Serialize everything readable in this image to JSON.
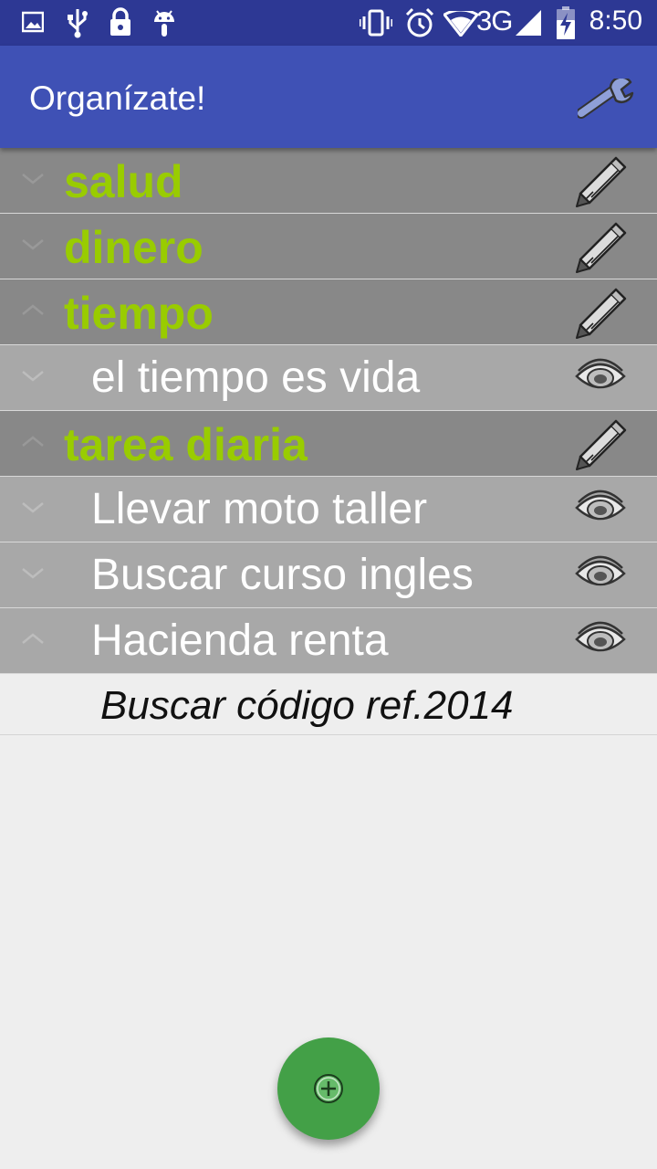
{
  "status_bar": {
    "time": "8:50",
    "network": "3G",
    "icons": [
      "image-icon",
      "usb-icon",
      "lock-icon",
      "android-icon",
      "vibrate-icon",
      "alarm-icon",
      "wifi-icon",
      "signal-icon",
      "battery-charging-icon"
    ]
  },
  "app_bar": {
    "title": "Organízate!",
    "settings_icon": "wrench-icon"
  },
  "list": {
    "rows": [
      {
        "label": "salud",
        "type": "group",
        "expanded": false,
        "action_icon": "pencil-icon"
      },
      {
        "label": "dinero",
        "type": "group",
        "expanded": false,
        "action_icon": "pencil-icon"
      },
      {
        "label": "tiempo",
        "type": "group",
        "expanded": true,
        "action_icon": "pencil-icon"
      },
      {
        "label": "el tiempo es vida",
        "type": "child",
        "expanded": false,
        "action_icon": "eye-icon"
      },
      {
        "label": "tarea diaria",
        "type": "group",
        "expanded": true,
        "action_icon": "pencil-icon"
      },
      {
        "label": "Llevar moto taller",
        "type": "child",
        "expanded": false,
        "action_icon": "eye-icon"
      },
      {
        "label": "Buscar curso ingles",
        "type": "child",
        "expanded": false,
        "action_icon": "eye-icon"
      },
      {
        "label": "Hacienda renta",
        "type": "child",
        "expanded": true,
        "action_icon": "eye-icon"
      }
    ],
    "note": "Buscar código ref.2014"
  },
  "fab": {
    "icon": "add-circle-icon"
  },
  "colors": {
    "status_bar": "#2d3894",
    "app_bar": "#3f51b5",
    "group_row": "#888888",
    "child_row": "#a8a8a8",
    "group_text": "#99cc00",
    "fab": "#43a047"
  }
}
